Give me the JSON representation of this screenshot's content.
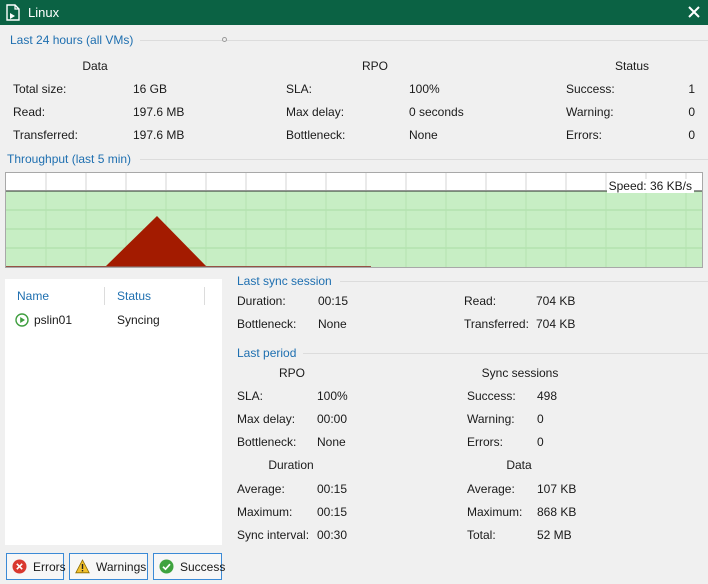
{
  "window": {
    "title": "Linux"
  },
  "summary": {
    "title": "Last 24 hours (all VMs)",
    "data": {
      "header": "Data",
      "rows": [
        {
          "label": "Total size:",
          "value": "16 GB"
        },
        {
          "label": "Read:",
          "value": "197.6 MB"
        },
        {
          "label": "Transferred:",
          "value": "197.6 MB"
        }
      ]
    },
    "rpo": {
      "header": "RPO",
      "rows": [
        {
          "label": "SLA:",
          "value": "100%"
        },
        {
          "label": "Max delay:",
          "value": "0 seconds"
        },
        {
          "label": "Bottleneck:",
          "value": "None"
        }
      ]
    },
    "status": {
      "header": "Status",
      "rows": [
        {
          "label": "Success:",
          "value": "1"
        },
        {
          "label": "Warning:",
          "value": "0"
        },
        {
          "label": "Errors:",
          "value": "0"
        }
      ]
    }
  },
  "throughput": {
    "title": "Throughput (last 5 min)",
    "speed_label": "Speed: 36 KB/s",
    "colors": {
      "fill": "#c7eec4",
      "peak": "#a31b00",
      "line": "#2a2a2a"
    }
  },
  "vm_list": {
    "columns": [
      "Name",
      "Status"
    ],
    "rows": [
      {
        "name": "pslin01",
        "status": "Syncing",
        "icon": "play-circle-icon"
      }
    ]
  },
  "last_sync": {
    "title": "Last sync session",
    "left": [
      {
        "label": "Duration:",
        "value": "00:15"
      },
      {
        "label": "Bottleneck:",
        "value": "None"
      }
    ],
    "right": [
      {
        "label": "Read:",
        "value": "704 KB"
      },
      {
        "label": "Transferred:",
        "value": "704 KB"
      }
    ]
  },
  "last_period": {
    "title": "Last period",
    "rpo": {
      "header": "RPO",
      "rows": [
        {
          "label": "SLA:",
          "value": "100%"
        },
        {
          "label": "Max delay:",
          "value": "00:00"
        },
        {
          "label": "Bottleneck:",
          "value": "None"
        }
      ]
    },
    "sync_sessions": {
      "header": "Sync sessions",
      "rows": [
        {
          "label": "Success:",
          "value": "498"
        },
        {
          "label": "Warning:",
          "value": "0"
        },
        {
          "label": "Errors:",
          "value": "0"
        }
      ]
    },
    "duration": {
      "header": "Duration",
      "rows": [
        {
          "label": "Average:",
          "value": "00:15"
        },
        {
          "label": "Maximum:",
          "value": "00:15"
        },
        {
          "label": "Sync interval:",
          "value": "00:30"
        }
      ]
    },
    "data": {
      "header": "Data",
      "rows": [
        {
          "label": "Average:",
          "value": "107 KB"
        },
        {
          "label": "Maximum:",
          "value": "868 KB"
        },
        {
          "label": "Total:",
          "value": "52 MB"
        }
      ]
    }
  },
  "filters": {
    "errors": "Errors",
    "warnings": "Warnings",
    "success": "Success"
  }
}
